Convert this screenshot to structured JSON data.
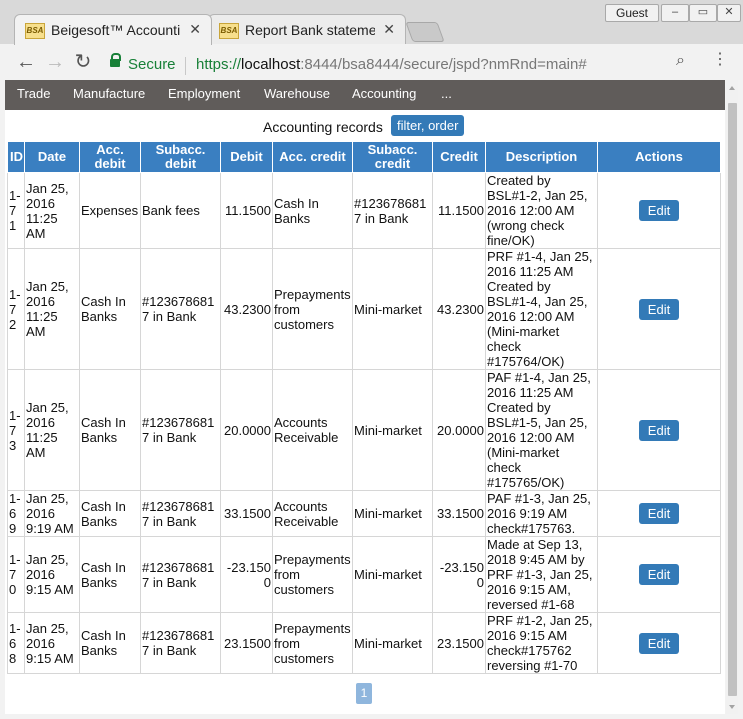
{
  "browser": {
    "tabs": [
      {
        "favicon": "BSA",
        "title": "Beigesoft™ Accounti"
      },
      {
        "favicon": "BSA",
        "title": "Report Bank stateme"
      }
    ],
    "profile": "Guest",
    "secure_label": "Secure",
    "url": {
      "scheme": "https://",
      "host": "localhost",
      "rest": ":8444/bsa8444/secure/jspd?nmRnd=main#"
    }
  },
  "nav": {
    "items": [
      "Trade",
      "Manufacture",
      "Employment",
      "Warehouse",
      "Accounting",
      "..."
    ]
  },
  "page": {
    "title": "Accounting records",
    "filter_label": "filter, order"
  },
  "table": {
    "headers": [
      "ID",
      "Date",
      "Acc. debit",
      "Subacc. debit",
      "Debit",
      "Acc. credit",
      "Subacc. credit",
      "Credit",
      "Description",
      "Actions"
    ],
    "edit_label": "Edit",
    "rows": [
      {
        "id": "1-71",
        "date": "Jan 25, 2016 11:25 AM",
        "acc_debit": "Expenses",
        "subacc_debit": "Bank fees",
        "debit": "11.1500",
        "acc_credit": "Cash In Banks",
        "subacc_credit": "#1236786817 in Bank",
        "credit": "11.1500",
        "description": "Created by BSL#1-2, Jan 25, 2016 12:00 AM (wrong check fine/OK)"
      },
      {
        "id": "1-72",
        "date": "Jan 25, 2016 11:25 AM",
        "acc_debit": "Cash In Banks",
        "subacc_debit": "#1236786817 in Bank",
        "debit": "43.2300",
        "acc_credit": "Prepayments from customers",
        "subacc_credit": "Mini-market",
        "credit": "43.2300",
        "description": "PRF #1-4, Jan 25, 2016 11:25 AM Created by BSL#1-4, Jan 25, 2016 12:00 AM (Mini-market check #175764/OK)"
      },
      {
        "id": "1-73",
        "date": "Jan 25, 2016 11:25 AM",
        "acc_debit": "Cash In Banks",
        "subacc_debit": "#1236786817 in Bank",
        "debit": "20.0000",
        "acc_credit": "Accounts Receivable",
        "subacc_credit": "Mini-market",
        "credit": "20.0000",
        "description": "PAF #1-4, Jan 25, 2016 11:25 AM Created by BSL#1-5, Jan 25, 2016 12:00 AM (Mini-market check #175765/OK)"
      },
      {
        "id": "1-69",
        "date": "Jan 25, 2016 9:19 AM",
        "acc_debit": "Cash In Banks",
        "subacc_debit": "#1236786817 in Bank",
        "debit": "33.1500",
        "acc_credit": "Accounts Receivable",
        "subacc_credit": "Mini-market",
        "credit": "33.1500",
        "description": "PAF #1-3, Jan 25, 2016 9:19 AM check#175763."
      },
      {
        "id": "1-70",
        "date": "Jan 25, 2016 9:15 AM",
        "acc_debit": "Cash In Banks",
        "subacc_debit": "#1236786817 in Bank",
        "debit": "-23.1500",
        "acc_credit": "Prepayments from customers",
        "subacc_credit": "Mini-market",
        "credit": "-23.1500",
        "description": "Made at Sep 13, 2018 9:45 AM by PRF #1-3, Jan 25, 2016 9:15 AM, reversed #1-68"
      },
      {
        "id": "1-68",
        "date": "Jan 25, 2016 9:15 AM",
        "acc_debit": "Cash In Banks",
        "subacc_debit": "#1236786817 in Bank",
        "debit": "23.1500",
        "acc_credit": "Prepayments from customers",
        "subacc_credit": "Mini-market",
        "credit": "23.1500",
        "description": "PRF #1-2, Jan 25, 2016 9:15 AM check#175762 reversing #1-70"
      }
    ]
  },
  "pagination": {
    "current": "1"
  }
}
